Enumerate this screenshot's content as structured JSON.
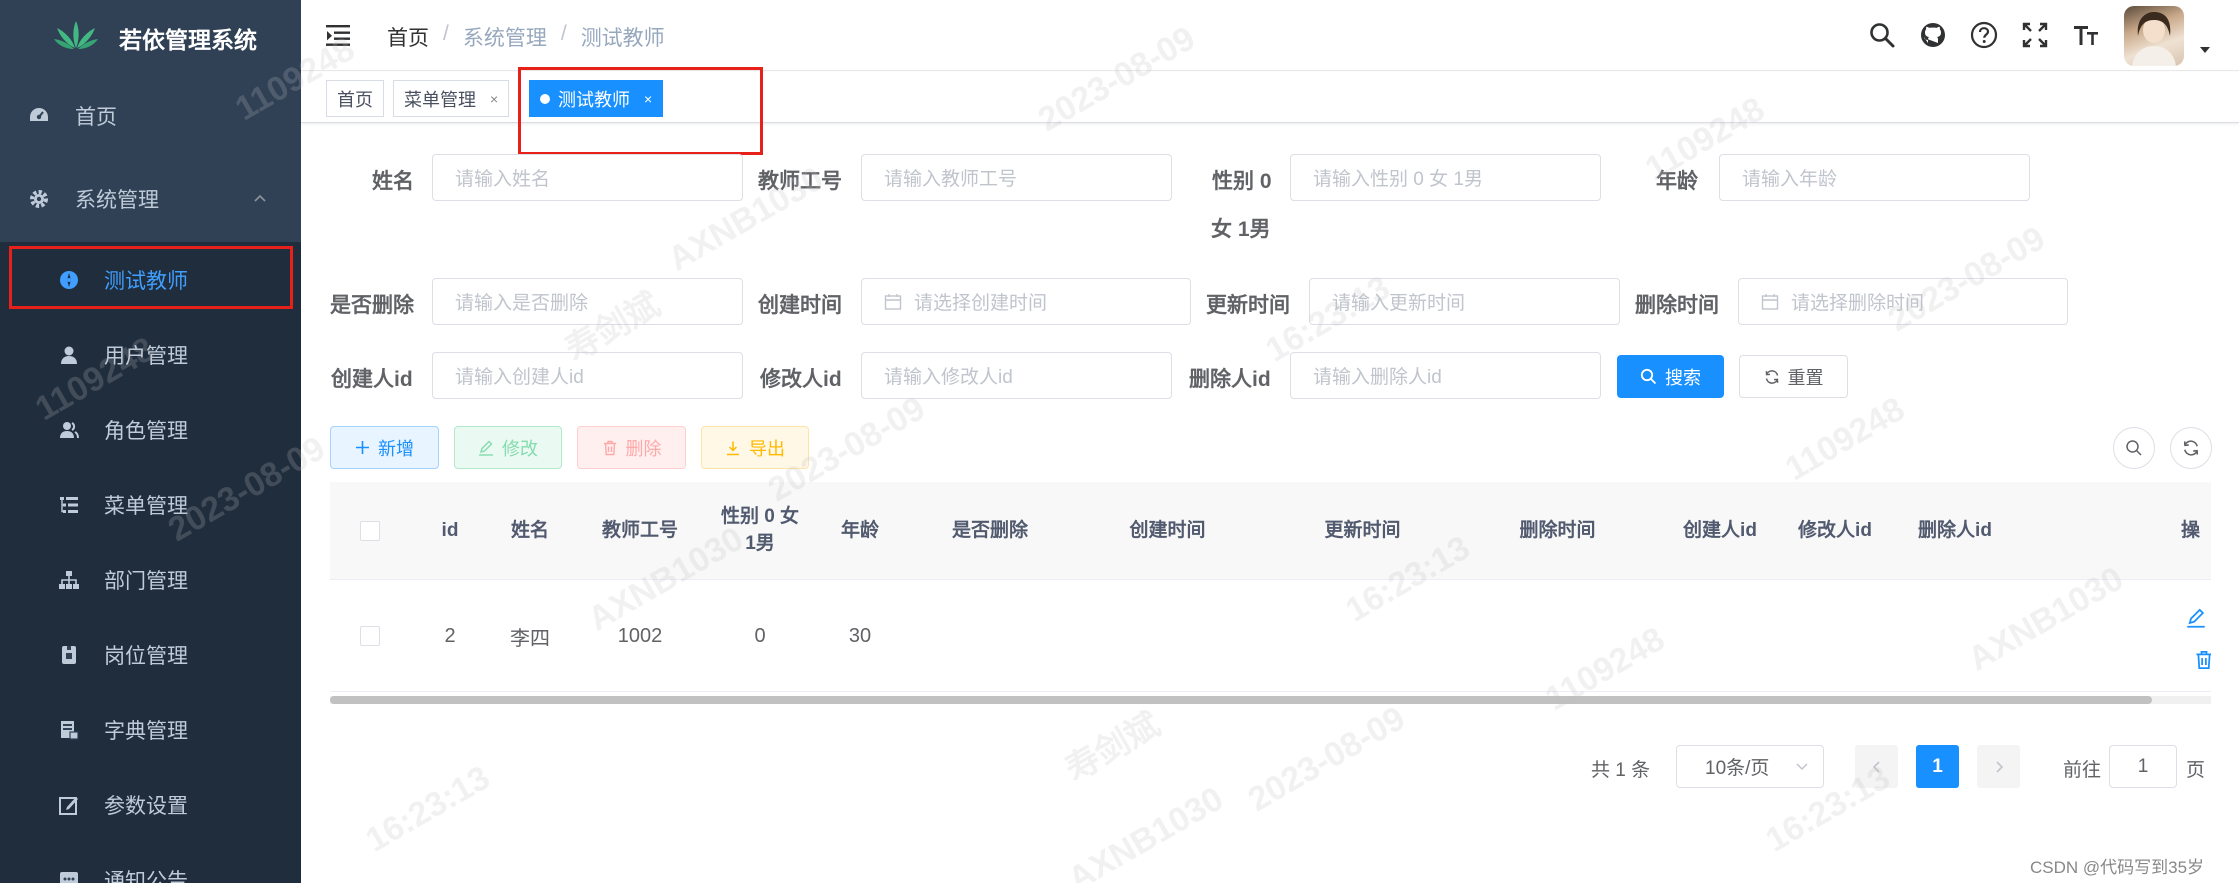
{
  "app": {
    "title": "若依管理系统",
    "logo_icon": "ruoyi-leaf-logo"
  },
  "sidebar": {
    "items": [
      {
        "label": "首页",
        "icon": "dashboard-icon",
        "level": "top"
      },
      {
        "label": "系统管理",
        "icon": "gear-icon",
        "level": "top",
        "expanded": true
      },
      {
        "label": "测试教师",
        "icon": "compass-icon",
        "level": "sub",
        "active": true
      },
      {
        "label": "用户管理",
        "icon": "user-icon",
        "level": "sub"
      },
      {
        "label": "角色管理",
        "icon": "peoples-icon",
        "level": "sub"
      },
      {
        "label": "菜单管理",
        "icon": "tree-table-icon",
        "level": "sub"
      },
      {
        "label": "部门管理",
        "icon": "tree-icon",
        "level": "sub"
      },
      {
        "label": "岗位管理",
        "icon": "post-icon",
        "level": "sub"
      },
      {
        "label": "字典管理",
        "icon": "dict-icon",
        "level": "sub"
      },
      {
        "label": "参数设置",
        "icon": "edit-icon",
        "level": "sub"
      },
      {
        "label": "通知公告",
        "icon": "message-icon",
        "level": "sub"
      }
    ]
  },
  "breadcrumb": [
    "首页",
    "系统管理",
    "测试教师"
  ],
  "tags": [
    {
      "label": "首页",
      "closable": false,
      "active": false
    },
    {
      "label": "菜单管理",
      "closable": true,
      "active": false
    },
    {
      "label": "测试教师",
      "closable": true,
      "active": true
    }
  ],
  "tag_close_glyph": "×",
  "search": {
    "fields": [
      {
        "label": "姓名",
        "placeholder": "请输入姓名"
      },
      {
        "label": "教师工号",
        "placeholder": "请输入教师工号"
      },
      {
        "label": "性别 0",
        "label2": "女 1男",
        "placeholder": "请输入性别 0 女 1男"
      },
      {
        "label": "年龄",
        "placeholder": "请输入年龄"
      },
      {
        "label": "是否删除",
        "placeholder": "请输入是否删除"
      },
      {
        "label": "创建时间",
        "placeholder": "请选择创建时间"
      },
      {
        "label": "更新时间",
        "placeholder": "请输入更新时间"
      },
      {
        "label": "删除时间",
        "placeholder": "请选择删除时间"
      },
      {
        "label": "创建人id",
        "placeholder": "请输入创建人id"
      },
      {
        "label": "修改人id",
        "placeholder": "请输入修改人id"
      },
      {
        "label": "删除人id",
        "placeholder": "请输入删除人id"
      }
    ],
    "search_label": "搜索",
    "reset_label": "重置"
  },
  "toolbar": {
    "add_label": "新增",
    "edit_label": "修改",
    "delete_label": "删除",
    "export_label": "导出"
  },
  "table": {
    "headers": [
      "id",
      "姓名",
      "教师工号",
      "性别 0 女",
      "1男",
      "年龄",
      "是否删除",
      "创建时间",
      "更新时间",
      "删除时间",
      "创建人id",
      "修改人id",
      "删除人id",
      "操"
    ],
    "rows": [
      {
        "id": "2",
        "name": "李四",
        "teacher_no": "1002",
        "gender": "0",
        "age": "30",
        "is_deleted": "",
        "created_at": "",
        "updated_at": "",
        "deleted_at": "",
        "created_by": "",
        "updated_by": "",
        "deleted_by": ""
      }
    ]
  },
  "pagination": {
    "total_text": "共 1 条",
    "page_size": "10条/页",
    "current_page": "1",
    "goto_label": "前往",
    "goto_value": "1",
    "page_suffix": "页"
  },
  "watermark": {
    "texts": [
      "1109248",
      "2023-08-09",
      "16:23:13",
      "AXNB1030",
      "寿剑斌"
    ]
  },
  "footer_credit": "CSDN @代码写到35岁",
  "colors": {
    "sidebar_bg": "#304156",
    "sidebar_sub_bg": "#1f2d3d",
    "primary": "#1890ff",
    "tag_active": "#1890ff",
    "highlight_red": "#e8201a"
  }
}
